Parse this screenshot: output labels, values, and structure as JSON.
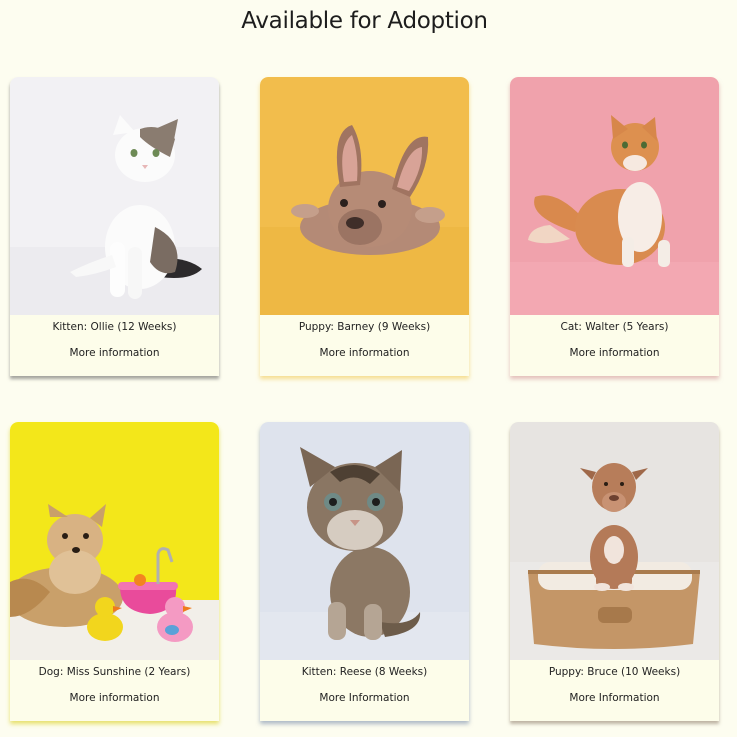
{
  "page": {
    "title": "Available for Adoption"
  },
  "pets": [
    {
      "caption": "Kitten: Ollie (12 Weeks)",
      "link": "More information",
      "photo": "white-tabby-kitten-photo",
      "bg": "#f1f0f3"
    },
    {
      "caption": "Puppy: Barney (9 Weeks)",
      "link": "More information",
      "photo": "french-bulldog-puppy-photo",
      "bg": "#f2bd4c"
    },
    {
      "caption": "Cat: Walter (5 Years)",
      "link": "More information",
      "photo": "orange-cat-photo",
      "bg": "#f0a1ab"
    },
    {
      "caption": "Dog: Miss Sunshine (2 Years)",
      "link": "More information",
      "photo": "chihuahua-with-rubber-ducks-photo",
      "bg": "#f3e71a"
    },
    {
      "caption": "Kitten: Reese (8 Weeks)",
      "link": "More Information",
      "photo": "tabby-kitten-photo",
      "bg": "#dfe4ee"
    },
    {
      "caption": "Puppy: Bruce (10 Weeks)",
      "link": "More Information",
      "photo": "puppy-in-basket-photo",
      "bg": "#e6e3e0"
    }
  ]
}
